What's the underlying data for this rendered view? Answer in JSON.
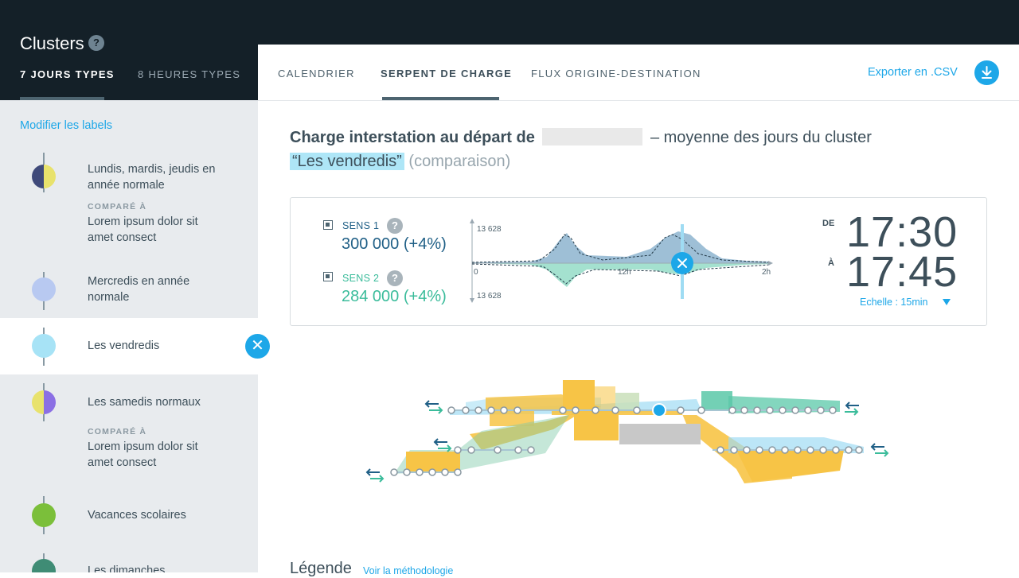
{
  "sidebar": {
    "title": "Clusters",
    "help_glyph": "?",
    "tabs": [
      {
        "label": "7 JOURS TYPES",
        "active": true
      },
      {
        "label": "8 HEURES TYPES",
        "active": false
      }
    ],
    "modify_link": "Modifier les labels",
    "compared_label": "COMPARÉ À",
    "clusters": [
      {
        "label": "Lundis, mardis, jeudis en année normale",
        "compared_to": "Lorem ipsum dolor sit amet consect",
        "color_left": "#3f4a7a",
        "color_right": "#e8e26c"
      },
      {
        "label": "Mercredis en année normale",
        "color_left": "#b8c9f1",
        "color_right": "#b8c9f1"
      },
      {
        "label": "Les vendredis",
        "color_left": "#a7e3f6",
        "color_right": "#a7e3f6",
        "active": true
      },
      {
        "label": "Les samedis normaux",
        "compared_to": "Lorem ipsum dolor sit amet consect",
        "color_left": "#e8e26c",
        "color_right": "#8b6fe4"
      },
      {
        "label": "Vacances scolaires",
        "color_left": "#7bbf3a",
        "color_right": "#7bbf3a"
      },
      {
        "label": "Les dimanches",
        "color_left": "#3f8c75",
        "color_right": "#3f8c75"
      }
    ],
    "remove_glyph": "✕"
  },
  "tabs": [
    {
      "label": "CALENDRIER",
      "active": false
    },
    {
      "label": "SERPENT DE CHARGE",
      "active": true
    },
    {
      "label": "FLUX ORIGINE-DESTINATION",
      "active": false
    }
  ],
  "export_label": "Exporter en .CSV",
  "heading": {
    "bold": "Charge interstation au départ de",
    "rest": "– moyenne des jours du cluster",
    "cluster_name": "“Les vendredis”",
    "suffix": "(comparaison)"
  },
  "card": {
    "sens1": {
      "label": "SENS 1",
      "value": "300 000 (+4%)",
      "color": "#1f5f86"
    },
    "sens2": {
      "label": "SENS 2",
      "value": "284 000 (+4%)",
      "color": "#3bbc9b"
    },
    "help_glyph": "?",
    "chart_axis": {
      "top": "13 628",
      "bottom": "13 628",
      "x0": "0",
      "xmid": "12h",
      "xend": "2h"
    },
    "de_label": "DE",
    "a_label": "À",
    "time_from": "17:30",
    "time_to": "17:45",
    "scale_label": "Echelle  : 15min"
  },
  "legend": {
    "title": "Légende",
    "link": "Voir la méthodologie"
  },
  "colors": {
    "accent": "#1da7e8",
    "dark": "#142028",
    "yellow": "#f7c446",
    "teal": "#5ac8a8",
    "blue": "#7eaac8"
  }
}
